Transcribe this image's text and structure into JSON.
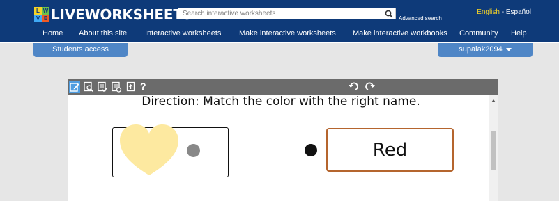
{
  "header": {
    "logo_text": "LIVEWORKSHEETS",
    "logo_letters": [
      "L",
      "W",
      "V",
      "E"
    ],
    "search_placeholder": "Search interactive worksheets",
    "advanced_search": "Advanced search",
    "lang_english": "English",
    "lang_separator": " - ",
    "lang_spanish": "Español"
  },
  "nav": {
    "items": [
      "Home",
      "About this site",
      "Interactive worksheets",
      "Make interactive worksheets",
      "Make interactive workbooks",
      "Community",
      "Help"
    ]
  },
  "tabs": {
    "students_access": "Students access",
    "username": "supalak2094"
  },
  "toolbar": {
    "icons": [
      "edit-icon",
      "preview-icon",
      "check-icon",
      "check-answers-icon",
      "export-icon"
    ],
    "help_label": "?",
    "undo_icon": "undo-icon",
    "redo_icon": "redo-icon"
  },
  "worksheet": {
    "direction": "Direction: Match the color with the right name.",
    "answer_word": "Red",
    "heart_color": "#fde9a0",
    "answer_box_border": "#b5652e"
  },
  "colors": {
    "header_bg": "#0e3a79",
    "tab_bg": "#4f86c6",
    "toolbar_bg": "#6b6b6b",
    "lang_active": "#f5d327"
  }
}
